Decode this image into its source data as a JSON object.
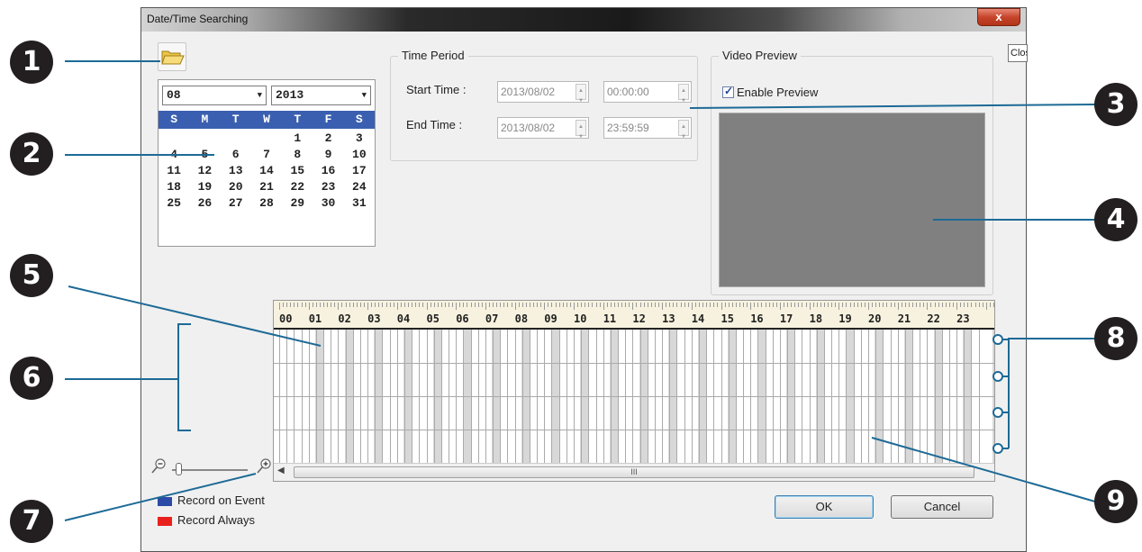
{
  "window": {
    "title": "Date/Time Searching",
    "close_label": "x",
    "tooltip_text": "Close"
  },
  "toolbar": {
    "folder_icon": "folder-open-icon"
  },
  "calendar": {
    "month": "08",
    "year": "2013",
    "weekdays": [
      "S",
      "M",
      "T",
      "W",
      "T",
      "F",
      "S"
    ],
    "weeks": [
      [
        "",
        "",
        "",
        "",
        "1",
        "2",
        "3"
      ],
      [
        "4",
        "5",
        "6",
        "7",
        "8",
        "9",
        "10"
      ],
      [
        "11",
        "12",
        "13",
        "14",
        "15",
        "16",
        "17"
      ],
      [
        "18",
        "19",
        "20",
        "21",
        "22",
        "23",
        "24"
      ],
      [
        "25",
        "26",
        "27",
        "28",
        "29",
        "30",
        "31"
      ]
    ],
    "header_color": "#3b5fb0"
  },
  "time_period": {
    "title": "Time Period",
    "start_label": "Start Time :",
    "start_date": "2013/08/02",
    "start_time": "00:00:00",
    "end_label": "End Time :",
    "end_date": "2013/08/02",
    "end_time": "23:59:59"
  },
  "video_preview": {
    "title": "Video Preview",
    "enable_label": "Enable Preview",
    "enabled": true
  },
  "timeline": {
    "hours": [
      "00",
      "01",
      "02",
      "03",
      "04",
      "05",
      "06",
      "07",
      "08",
      "09",
      "10",
      "11",
      "12",
      "13",
      "14",
      "15",
      "16",
      "17",
      "18",
      "19",
      "20",
      "21",
      "22",
      "23"
    ],
    "channel_rows": 4,
    "scroll_grip": "III"
  },
  "zoom": {
    "out_icon": "zoom-out-icon",
    "in_icon": "zoom-in-icon",
    "level": 0.05
  },
  "legend": [
    {
      "label": "Record on Event",
      "color": "#2c4ba6"
    },
    {
      "label": "Record Always",
      "color": "#e8211d"
    }
  ],
  "buttons": {
    "ok": "OK",
    "cancel": "Cancel"
  },
  "callouts": [
    "1",
    "2",
    "3",
    "4",
    "5",
    "6",
    "7",
    "8",
    "9"
  ]
}
